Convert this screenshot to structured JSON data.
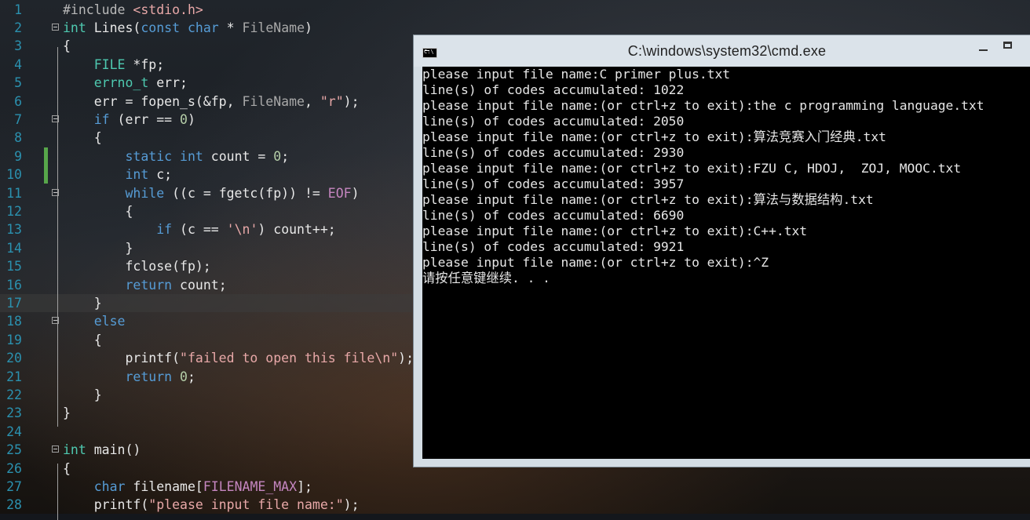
{
  "editor": {
    "lines": [
      {
        "n": "1",
        "t": [
          [
            "pp",
            "#include "
          ],
          [
            "st",
            "<stdio.h>"
          ]
        ]
      },
      {
        "n": "2",
        "fold": true,
        "t": [
          [
            "ty",
            "int"
          ],
          [
            "fn",
            " Lines("
          ],
          [
            "kw",
            "const"
          ],
          [
            "fn",
            " "
          ],
          [
            "kw",
            "char"
          ],
          [
            "fn",
            " * "
          ],
          [
            "pa",
            "FileName"
          ],
          [
            "fn",
            ")"
          ]
        ]
      },
      {
        "n": "3",
        "t": [
          [
            "fn",
            "{"
          ]
        ]
      },
      {
        "n": "4",
        "t": [
          [
            "fn",
            "    "
          ],
          [
            "ty",
            "FILE"
          ],
          [
            "fn",
            " *fp;"
          ]
        ]
      },
      {
        "n": "5",
        "t": [
          [
            "fn",
            "    "
          ],
          [
            "ty",
            "errno_t"
          ],
          [
            "fn",
            " err;"
          ]
        ]
      },
      {
        "n": "6",
        "t": [
          [
            "fn",
            "    err = fopen_s(&fp, "
          ],
          [
            "pa",
            "FileName"
          ],
          [
            "fn",
            ", "
          ],
          [
            "st",
            "\"r\""
          ],
          [
            "fn",
            ");"
          ]
        ]
      },
      {
        "n": "7",
        "fold": true,
        "t": [
          [
            "fn",
            "    "
          ],
          [
            "kw",
            "if"
          ],
          [
            "fn",
            " (err == "
          ],
          [
            "nm",
            "0"
          ],
          [
            "fn",
            ")"
          ]
        ]
      },
      {
        "n": "8",
        "t": [
          [
            "fn",
            "    {"
          ]
        ]
      },
      {
        "n": "9",
        "mark": true,
        "t": [
          [
            "fn",
            "        "
          ],
          [
            "kw",
            "static"
          ],
          [
            "fn",
            " "
          ],
          [
            "kw",
            "int"
          ],
          [
            "fn",
            " count = "
          ],
          [
            "nm",
            "0"
          ],
          [
            "fn",
            ";"
          ]
        ]
      },
      {
        "n": "10",
        "mark": true,
        "t": [
          [
            "fn",
            "        "
          ],
          [
            "kw",
            "int"
          ],
          [
            "fn",
            " c;"
          ]
        ]
      },
      {
        "n": "11",
        "fold": true,
        "t": [
          [
            "fn",
            "        "
          ],
          [
            "kw",
            "while"
          ],
          [
            "fn",
            " ((c = fgetc(fp)) != "
          ],
          [
            "mac",
            "EOF"
          ],
          [
            "fn",
            ")"
          ]
        ]
      },
      {
        "n": "12",
        "t": [
          [
            "fn",
            "        {"
          ]
        ]
      },
      {
        "n": "13",
        "t": [
          [
            "fn",
            "            "
          ],
          [
            "kw",
            "if"
          ],
          [
            "fn",
            " (c == "
          ],
          [
            "st",
            "'\\n'"
          ],
          [
            "fn",
            ") count++;"
          ]
        ]
      },
      {
        "n": "14",
        "t": [
          [
            "fn",
            "        }"
          ]
        ]
      },
      {
        "n": "15",
        "t": [
          [
            "fn",
            "        fclose(fp);"
          ]
        ]
      },
      {
        "n": "16",
        "t": [
          [
            "fn",
            "        "
          ],
          [
            "kw",
            "return"
          ],
          [
            "fn",
            " count;"
          ]
        ]
      },
      {
        "n": "17",
        "current": true,
        "t": [
          [
            "fn",
            "    }"
          ]
        ]
      },
      {
        "n": "18",
        "fold": true,
        "t": [
          [
            "fn",
            "    "
          ],
          [
            "kw",
            "else"
          ]
        ]
      },
      {
        "n": "19",
        "t": [
          [
            "fn",
            "    {"
          ]
        ]
      },
      {
        "n": "20",
        "t": [
          [
            "fn",
            "        printf("
          ],
          [
            "st",
            "\"failed to open this file\\n\""
          ],
          [
            "fn",
            ");"
          ]
        ]
      },
      {
        "n": "21",
        "t": [
          [
            "fn",
            "        "
          ],
          [
            "kw",
            "return"
          ],
          [
            "fn",
            " "
          ],
          [
            "nm",
            "0"
          ],
          [
            "fn",
            ";"
          ]
        ]
      },
      {
        "n": "22",
        "t": [
          [
            "fn",
            "    }"
          ]
        ]
      },
      {
        "n": "23",
        "t": [
          [
            "fn",
            "}"
          ]
        ]
      },
      {
        "n": "24",
        "t": []
      },
      {
        "n": "25",
        "fold": true,
        "t": [
          [
            "ty",
            "int"
          ],
          [
            "fn",
            " main()"
          ]
        ]
      },
      {
        "n": "26",
        "t": [
          [
            "fn",
            "{"
          ]
        ]
      },
      {
        "n": "27",
        "t": [
          [
            "fn",
            "    "
          ],
          [
            "kw",
            "char"
          ],
          [
            "fn",
            " filename["
          ],
          [
            "mac",
            "FILENAME_MAX"
          ],
          [
            "fn",
            "];"
          ]
        ]
      },
      {
        "n": "28",
        "t": [
          [
            "fn",
            "    printf("
          ],
          [
            "st",
            "\"please input file name:\""
          ],
          [
            "fn",
            ");"
          ]
        ]
      }
    ]
  },
  "cmd_window": {
    "title": "C:\\windows\\system32\\cmd.exe",
    "icon_label": "C:\\",
    "output_lines": [
      "please input file name:C primer plus.txt",
      "line(s) of codes accumulated: 1022",
      "please input file name:(or ctrl+z to exit):the c programming language.txt",
      "line(s) of codes accumulated: 2050",
      "please input file name:(or ctrl+z to exit):算法竞赛入门经典.txt",
      "line(s) of codes accumulated: 2930",
      "please input file name:(or ctrl+z to exit):FZU C, HDOJ,  ZOJ, MOOC.txt",
      "line(s) of codes accumulated: 3957",
      "please input file name:(or ctrl+z to exit):算法与数据结构.txt",
      "line(s) of codes accumulated: 6690",
      "please input file name:(or ctrl+z to exit):C++.txt",
      "line(s) of codes accumulated: 9921",
      "please input file name:(or ctrl+z to exit):^Z",
      "请按任意键继续. . ."
    ]
  }
}
